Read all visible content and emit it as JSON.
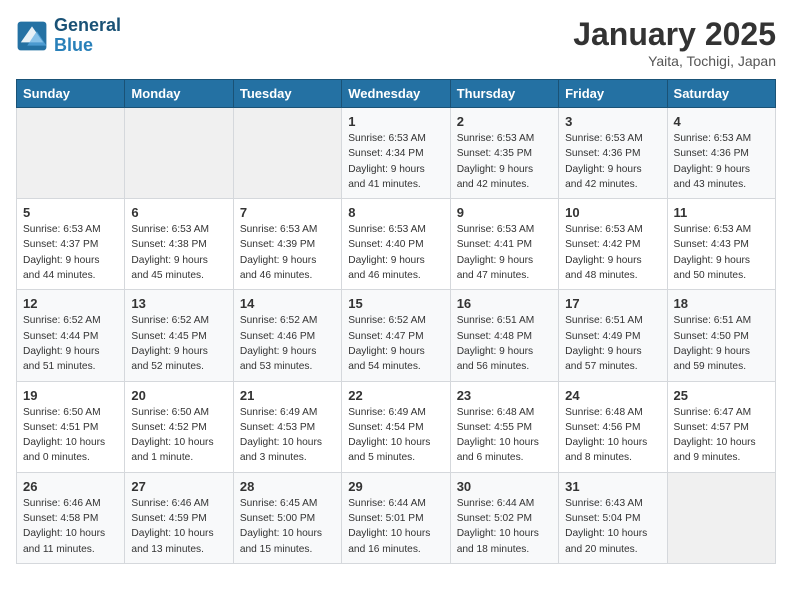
{
  "logo": {
    "line1": "General",
    "line2": "Blue"
  },
  "title": "January 2025",
  "subtitle": "Yaita, Tochigi, Japan",
  "headers": [
    "Sunday",
    "Monday",
    "Tuesday",
    "Wednesday",
    "Thursday",
    "Friday",
    "Saturday"
  ],
  "weeks": [
    [
      {
        "day": "",
        "info": ""
      },
      {
        "day": "",
        "info": ""
      },
      {
        "day": "",
        "info": ""
      },
      {
        "day": "1",
        "info": "Sunrise: 6:53 AM\nSunset: 4:34 PM\nDaylight: 9 hours and 41 minutes."
      },
      {
        "day": "2",
        "info": "Sunrise: 6:53 AM\nSunset: 4:35 PM\nDaylight: 9 hours and 42 minutes."
      },
      {
        "day": "3",
        "info": "Sunrise: 6:53 AM\nSunset: 4:36 PM\nDaylight: 9 hours and 42 minutes."
      },
      {
        "day": "4",
        "info": "Sunrise: 6:53 AM\nSunset: 4:36 PM\nDaylight: 9 hours and 43 minutes."
      }
    ],
    [
      {
        "day": "5",
        "info": "Sunrise: 6:53 AM\nSunset: 4:37 PM\nDaylight: 9 hours and 44 minutes."
      },
      {
        "day": "6",
        "info": "Sunrise: 6:53 AM\nSunset: 4:38 PM\nDaylight: 9 hours and 45 minutes."
      },
      {
        "day": "7",
        "info": "Sunrise: 6:53 AM\nSunset: 4:39 PM\nDaylight: 9 hours and 46 minutes."
      },
      {
        "day": "8",
        "info": "Sunrise: 6:53 AM\nSunset: 4:40 PM\nDaylight: 9 hours and 46 minutes."
      },
      {
        "day": "9",
        "info": "Sunrise: 6:53 AM\nSunset: 4:41 PM\nDaylight: 9 hours and 47 minutes."
      },
      {
        "day": "10",
        "info": "Sunrise: 6:53 AM\nSunset: 4:42 PM\nDaylight: 9 hours and 48 minutes."
      },
      {
        "day": "11",
        "info": "Sunrise: 6:53 AM\nSunset: 4:43 PM\nDaylight: 9 hours and 50 minutes."
      }
    ],
    [
      {
        "day": "12",
        "info": "Sunrise: 6:52 AM\nSunset: 4:44 PM\nDaylight: 9 hours and 51 minutes."
      },
      {
        "day": "13",
        "info": "Sunrise: 6:52 AM\nSunset: 4:45 PM\nDaylight: 9 hours and 52 minutes."
      },
      {
        "day": "14",
        "info": "Sunrise: 6:52 AM\nSunset: 4:46 PM\nDaylight: 9 hours and 53 minutes."
      },
      {
        "day": "15",
        "info": "Sunrise: 6:52 AM\nSunset: 4:47 PM\nDaylight: 9 hours and 54 minutes."
      },
      {
        "day": "16",
        "info": "Sunrise: 6:51 AM\nSunset: 4:48 PM\nDaylight: 9 hours and 56 minutes."
      },
      {
        "day": "17",
        "info": "Sunrise: 6:51 AM\nSunset: 4:49 PM\nDaylight: 9 hours and 57 minutes."
      },
      {
        "day": "18",
        "info": "Sunrise: 6:51 AM\nSunset: 4:50 PM\nDaylight: 9 hours and 59 minutes."
      }
    ],
    [
      {
        "day": "19",
        "info": "Sunrise: 6:50 AM\nSunset: 4:51 PM\nDaylight: 10 hours and 0 minutes."
      },
      {
        "day": "20",
        "info": "Sunrise: 6:50 AM\nSunset: 4:52 PM\nDaylight: 10 hours and 1 minute."
      },
      {
        "day": "21",
        "info": "Sunrise: 6:49 AM\nSunset: 4:53 PM\nDaylight: 10 hours and 3 minutes."
      },
      {
        "day": "22",
        "info": "Sunrise: 6:49 AM\nSunset: 4:54 PM\nDaylight: 10 hours and 5 minutes."
      },
      {
        "day": "23",
        "info": "Sunrise: 6:48 AM\nSunset: 4:55 PM\nDaylight: 10 hours and 6 minutes."
      },
      {
        "day": "24",
        "info": "Sunrise: 6:48 AM\nSunset: 4:56 PM\nDaylight: 10 hours and 8 minutes."
      },
      {
        "day": "25",
        "info": "Sunrise: 6:47 AM\nSunset: 4:57 PM\nDaylight: 10 hours and 9 minutes."
      }
    ],
    [
      {
        "day": "26",
        "info": "Sunrise: 6:46 AM\nSunset: 4:58 PM\nDaylight: 10 hours and 11 minutes."
      },
      {
        "day": "27",
        "info": "Sunrise: 6:46 AM\nSunset: 4:59 PM\nDaylight: 10 hours and 13 minutes."
      },
      {
        "day": "28",
        "info": "Sunrise: 6:45 AM\nSunset: 5:00 PM\nDaylight: 10 hours and 15 minutes."
      },
      {
        "day": "29",
        "info": "Sunrise: 6:44 AM\nSunset: 5:01 PM\nDaylight: 10 hours and 16 minutes."
      },
      {
        "day": "30",
        "info": "Sunrise: 6:44 AM\nSunset: 5:02 PM\nDaylight: 10 hours and 18 minutes."
      },
      {
        "day": "31",
        "info": "Sunrise: 6:43 AM\nSunset: 5:04 PM\nDaylight: 10 hours and 20 minutes."
      },
      {
        "day": "",
        "info": ""
      }
    ]
  ]
}
